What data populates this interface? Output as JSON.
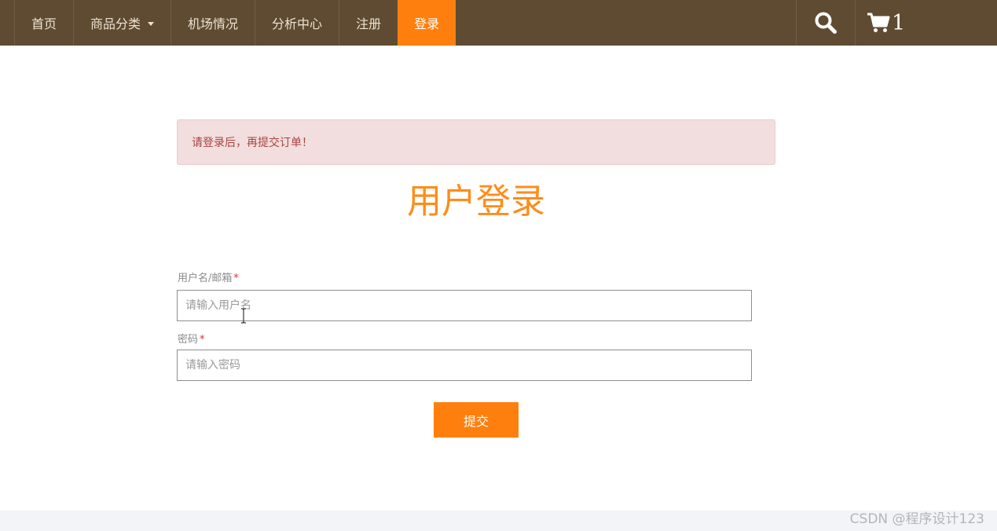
{
  "nav": {
    "items": [
      {
        "label": "首页"
      },
      {
        "label": "商品分类"
      },
      {
        "label": "机场情况"
      },
      {
        "label": "分析中心"
      },
      {
        "label": "注册"
      },
      {
        "label": "登录"
      }
    ],
    "cart_count": "1",
    "icons": {
      "search": "search-icon",
      "cart": "cart-icon",
      "dropdown": "caret-down-icon"
    }
  },
  "alert": {
    "message": "请登录后，再提交订单！"
  },
  "form": {
    "title": "用户登录",
    "username": {
      "label": "用户名/邮箱",
      "required_mark": "*",
      "placeholder": "请输入用户名",
      "value": ""
    },
    "password": {
      "label": "密码",
      "required_mark": "*",
      "placeholder": "请输入密码",
      "value": ""
    },
    "submit_label": "提交"
  },
  "watermark": "CSDN @程序设计123",
  "colors": {
    "nav_bg": "#5f4b32",
    "accent": "#ff7f0e",
    "alert_bg": "#f2dede",
    "alert_text": "#a94442"
  }
}
